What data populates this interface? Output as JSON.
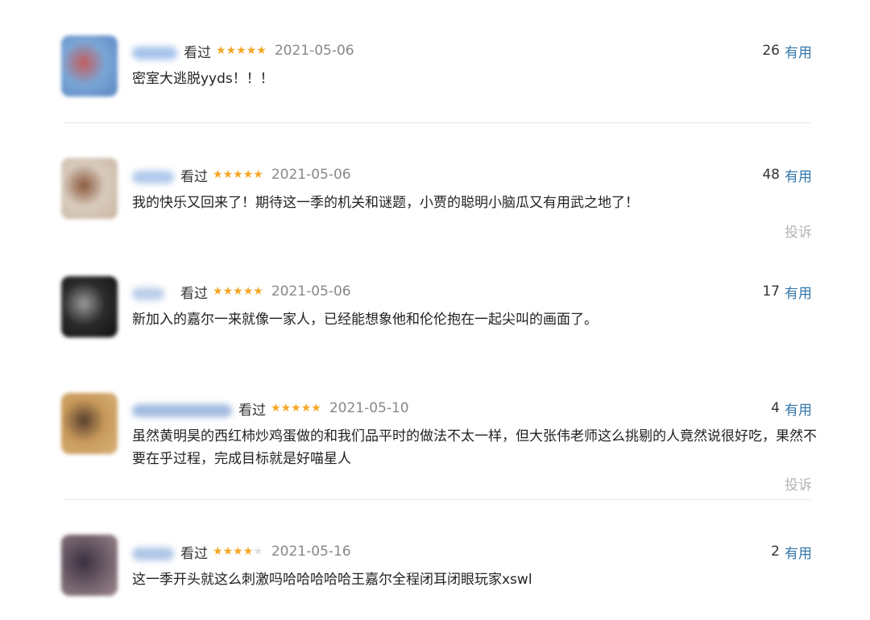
{
  "reviews": [
    {
      "status": "看过",
      "rating": 5,
      "date": "2021-05-06",
      "count": "26",
      "useful_label": "有用",
      "content": "密室大逃脱yyds！！！",
      "report_label": "",
      "avatar_colors": [
        "#7aa6d6",
        "#c55c5c",
        "#5b86c2"
      ]
    },
    {
      "status": "看过",
      "rating": 5,
      "date": "2021-05-06",
      "count": "48",
      "useful_label": "有用",
      "content": "我的快乐又回来了！期待这一季的机关和谜题，小贾的聪明小脑瓜又有用武之地了！",
      "report_label": "投诉",
      "avatar_colors": [
        "#d9cbbd",
        "#8a5a3e",
        "#c9b6a3"
      ]
    },
    {
      "status": "看过",
      "rating": 5,
      "date": "2021-05-06",
      "count": "17",
      "useful_label": "有用",
      "content": "新加入的嘉尔一来就像一家人，已经能想象他和伦伦抱在一起尖叫的画面了。",
      "report_label": "",
      "avatar_colors": [
        "#2b2b2b",
        "#9a9a9a",
        "#111111"
      ]
    },
    {
      "status": "看过",
      "rating": 5,
      "date": "2021-05-10",
      "count": "4",
      "useful_label": "有用",
      "content": "虽然黄明昊的西红柿炒鸡蛋做的和我们品平时的做法不太一样，但大张伟老师这么挑剔的人竟然说很好吃，果然不要在乎过程，完成目标就是好喵星人",
      "report_label": "投诉",
      "avatar_colors": [
        "#c89a5a",
        "#5a4030",
        "#d8b27a"
      ]
    },
    {
      "status": "看过",
      "rating": 4,
      "date": "2021-05-16",
      "count": "2",
      "useful_label": "有用",
      "content": "这一季开头就这么刺激吗哈哈哈哈哈王嘉尔全程闭耳闭眼玩家xswl",
      "report_label": "",
      "avatar_colors": [
        "#6b5a66",
        "#3a3040",
        "#a08a90"
      ]
    }
  ]
}
